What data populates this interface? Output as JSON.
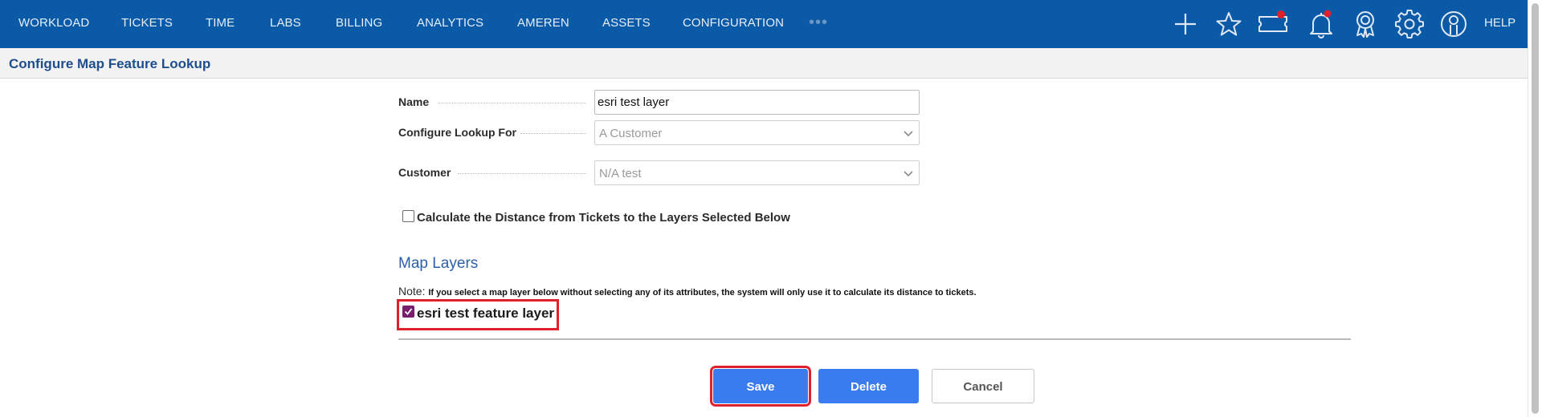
{
  "nav": {
    "items": [
      {
        "label": "WORKLOAD"
      },
      {
        "label": "TICKETS"
      },
      {
        "label": "TIME"
      },
      {
        "label": "LABS"
      },
      {
        "label": "BILLING"
      },
      {
        "label": "ANALYTICS"
      },
      {
        "label": "AMEREN"
      },
      {
        "label": "ASSETS"
      },
      {
        "label": "CONFIGURATION"
      }
    ],
    "more": "•••",
    "icons": [
      "add-icon",
      "star-icon",
      "ticket-icon",
      "bell-icon",
      "award-icon",
      "gear-icon",
      "user-icon"
    ],
    "help": "HELP",
    "notification_color": "#e0202a",
    "bar_color": "#0a5aa8"
  },
  "page": {
    "title": "Configure Map Feature Lookup"
  },
  "form": {
    "name_label": "Name",
    "name_value": "esri test layer",
    "lookup_for_label": "Configure Lookup For",
    "lookup_for_value": "A Customer",
    "customer_label": "Customer",
    "customer_value": "N/A test",
    "calculate_distance_label": "Calculate the Distance from Tickets to the Layers Selected Below",
    "calculate_distance_checked": false
  },
  "map_layers": {
    "title": "Map Layers",
    "note_prefix": "Note:",
    "note_text": "If you select a map layer below without selecting any of its attributes, the system will only use it to calculate its distance to tickets.",
    "layers": [
      {
        "label": "esri test feature layer",
        "checked": true
      }
    ]
  },
  "actions": {
    "save": "Save",
    "delete": "Delete",
    "cancel": "Cancel",
    "primary_color": "#3a7cf0",
    "highlight_color": "#e0202a"
  }
}
